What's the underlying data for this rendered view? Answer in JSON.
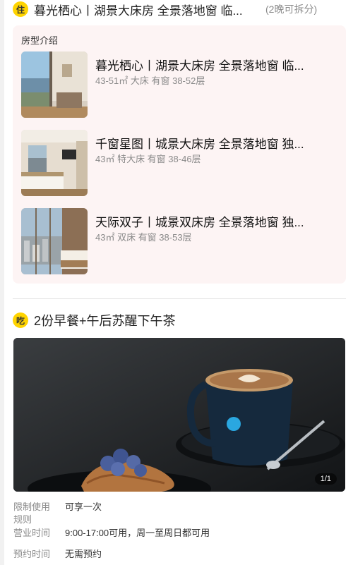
{
  "stay": {
    "badge": "住",
    "title": "暮光栖心丨湖景大床房 全景落地窗 临...",
    "note": "(2晚可拆分)"
  },
  "rooms": {
    "section_label": "房型介绍",
    "items": [
      {
        "name": "暮光栖心丨湖景大床房 全景落地窗 临...",
        "meta": "43-51㎡  大床  有窗  38-52层"
      },
      {
        "name": "千窗星图丨城景大床房 全景落地窗 独...",
        "meta": "43㎡  特大床  有窗  38-46层"
      },
      {
        "name": "天际双子丨城景双床房 全景落地窗 独...",
        "meta": "43㎡  双床  有窗  38-53层"
      }
    ]
  },
  "eat": {
    "badge": "吃",
    "title": "2份早餐+午后苏醒下午茶",
    "photo_counter": "1/1"
  },
  "rules": [
    {
      "label": "限制使用规则",
      "value": "可享一次"
    },
    {
      "label": "营业时间",
      "value": "9:00-17:00可用，周一至周日都可用"
    },
    {
      "label": "预约时间",
      "value": "无需预约"
    }
  ],
  "colors": {
    "badge": "#ffd400",
    "card_bg": "#fdf4f4",
    "muted_text": "#8a8a8a"
  },
  "icons": {
    "stay_badge": "circle-badge-stay",
    "eat_badge": "circle-badge-eat"
  }
}
